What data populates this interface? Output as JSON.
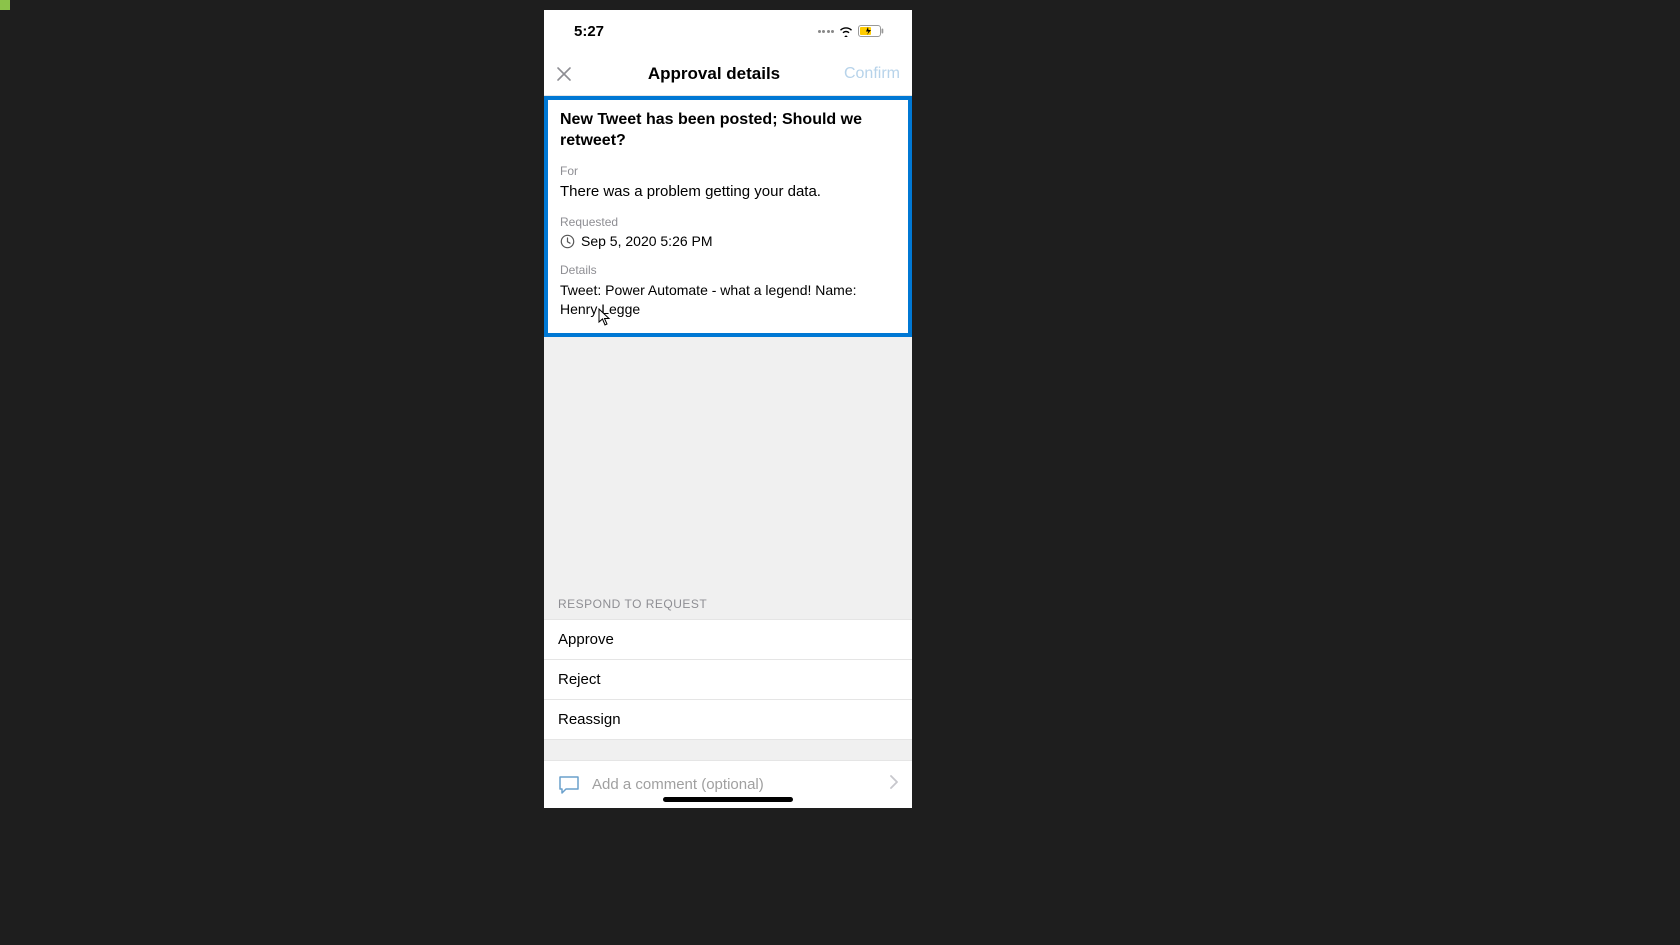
{
  "statusBar": {
    "time": "5:27"
  },
  "nav": {
    "title": "Approval details",
    "confirm": "Confirm"
  },
  "card": {
    "title": "New Tweet has been posted; Should we retweet?",
    "forLabel": "For",
    "forValue": "There was a problem getting your data.",
    "requestedLabel": "Requested",
    "requestedValue": "Sep 5, 2020 5:26 PM",
    "detailsLabel": "Details",
    "detailsValue": "Tweet: Power Automate - what a legend! Name: Henry Legge"
  },
  "respond": {
    "header": "RESPOND TO REQUEST",
    "actions": [
      "Approve",
      "Reject",
      "Reassign"
    ]
  },
  "comment": {
    "placeholder": "Add a comment (optional)"
  }
}
